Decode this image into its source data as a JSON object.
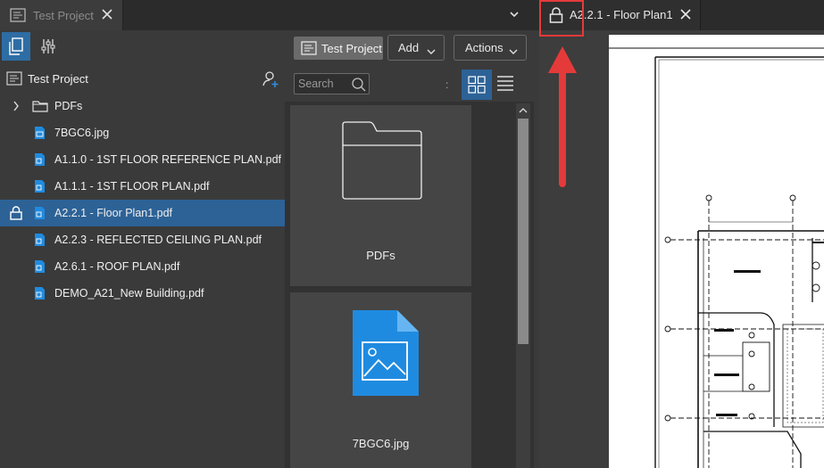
{
  "tabs": [
    {
      "label": "Test Project",
      "active": false
    },
    {
      "label": "A2.2.1 - Floor Plan1",
      "active": true,
      "locked": true
    }
  ],
  "left_panel": {
    "project_name": "Test Project",
    "tree": [
      {
        "label": "PDFs",
        "type": "folder"
      },
      {
        "label": "7BGC6.jpg",
        "type": "image"
      },
      {
        "label": "A1.1.0 - 1ST FLOOR REFERENCE PLAN.pdf",
        "type": "pdf"
      },
      {
        "label": "A1.1.1 - 1ST FLOOR PLAN.pdf",
        "type": "pdf"
      },
      {
        "label": "A2.2.1 - Floor Plan1.pdf",
        "type": "pdf",
        "selected": true,
        "locked": true
      },
      {
        "label": "A2.2.3 - REFLECTED CEILING PLAN.pdf",
        "type": "pdf"
      },
      {
        "label": "A2.6.1 - ROOF PLAN.pdf",
        "type": "pdf"
      },
      {
        "label": "DEMO_A21_New Building.pdf",
        "type": "pdf"
      }
    ]
  },
  "mid_panel": {
    "breadcrumb": "Test Project",
    "add_label": "Add",
    "actions_label": "Actions",
    "search_placeholder": "Search",
    "separator": ":",
    "cards": [
      {
        "label": "PDFs",
        "type": "folder"
      },
      {
        "label": "7BGC6.jpg",
        "type": "image"
      }
    ]
  },
  "colors": {
    "accent": "#2d6296",
    "highlight": "#e53a3a",
    "file_icon": "#1f8be0"
  }
}
